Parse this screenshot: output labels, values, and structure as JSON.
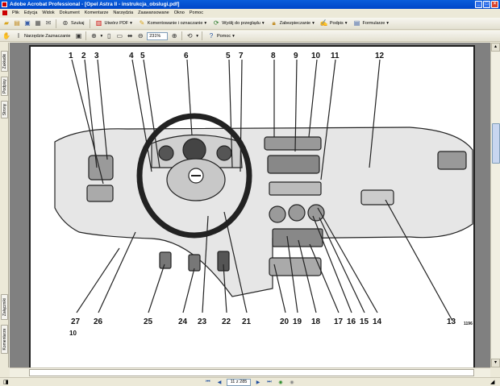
{
  "window": {
    "title": "Adobe Acrobat Professional - [Opel Astra II - instrukcja_obslugi.pdf]",
    "controls": [
      "_",
      "□",
      "×"
    ]
  },
  "menu": [
    "Plik",
    "Edycja",
    "Widok",
    "Dokument",
    "Komentarze",
    "Narzędzia",
    "Zaawansowane",
    "Okno",
    "Pomoc"
  ],
  "toolbar1": {
    "search_label": "Szukaj",
    "create_pdf_label": "Utwórz PDF",
    "comment_label": "Komentowanie i oznaczanie",
    "send_review_label": "Wyślij do przeglądu",
    "secure_label": "Zabezpieczanie",
    "sign_label": "Podpis",
    "forms_label": "Formularze"
  },
  "toolbar2": {
    "snapshot_label": "Narzędzie Zaznaczanie",
    "zoom_value": "231%",
    "help_label": "Pomoc"
  },
  "left_tabs": [
    "Zakładki",
    "Podpisy",
    "Strony",
    "Załączniki",
    "Komentarze"
  ],
  "document": {
    "callouts_top": [
      "1",
      "2",
      "3",
      "4",
      "5",
      "6",
      "5",
      "7",
      "8",
      "9",
      "10",
      "11",
      "12"
    ],
    "callouts_bottom": [
      "27",
      "26",
      "25",
      "24",
      "23",
      "22",
      "21",
      "20",
      "19",
      "18",
      "17",
      "16",
      "15",
      "14",
      "13"
    ],
    "page_number": "10",
    "figure_id": "1196"
  },
  "status": {
    "page_value": "11 z 285"
  }
}
